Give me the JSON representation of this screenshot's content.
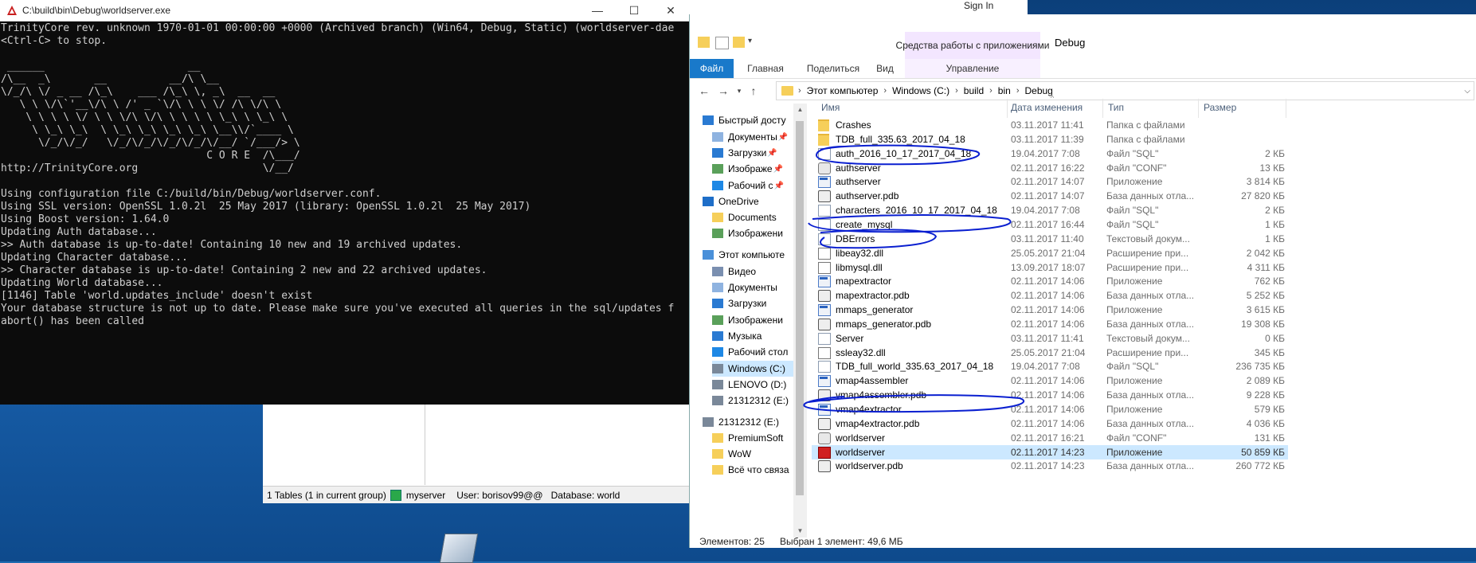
{
  "console": {
    "title": "C:\\build\\bin\\Debug\\worldserver.exe",
    "lines": [
      "TrinityCore rev. unknown 1970-01-01 00:00:00 +0000 (Archived branch) (Win64, Debug, Static) (worldserver-dae",
      "<Ctrl-C> to stop.",
      "",
      " ______                       __",
      "/\\__  _\\       __          __/\\ \\__",
      "\\/_/\\ \\/ _ __ /\\_\\    ___ /\\_\\ \\, _\\  __  __",
      "   \\ \\ \\/\\`'__\\/\\ \\ /' _ `\\/\\ \\ \\ \\/ /\\ \\/\\ \\",
      "    \\ \\ \\ \\ \\/ \\ \\ \\/\\ \\/\\ \\ \\ \\ \\ \\_\\ \\ \\_\\ \\",
      "     \\ \\_\\ \\_\\  \\ \\_\\ \\_\\ \\_\\ \\_\\ \\__\\\\/`____ \\",
      "      \\/_/\\/_/   \\/_/\\/_/\\/_/\\/_/\\/__/ `/___/> \\",
      "                                 C O R E  /\\___/",
      "http://TrinityCore.org                    \\/__/",
      "",
      "Using configuration file C:/build/bin/Debug/worldserver.conf.",
      "Using SSL version: OpenSSL 1.0.2l  25 May 2017 (library: OpenSSL 1.0.2l  25 May 2017)",
      "Using Boost version: 1.64.0",
      "Updating Auth database...",
      ">> Auth database is up-to-date! Containing 10 new and 19 archived updates.",
      "Updating Character database...",
      ">> Character database is up-to-date! Containing 2 new and 22 archived updates.",
      "Updating World database...",
      "[1146] Table 'world.updates_include' doesn't exist",
      "Your database structure is not up to date. Please make sure you've executed all queries in the sql/updates f",
      "abort() has been called"
    ]
  },
  "bgapp": {
    "status_tables": "1 Tables (1 in current group)",
    "server": "myserver",
    "user": "User: borisov99@@",
    "database": "Database: world"
  },
  "signin": "Sign In",
  "explorer": {
    "context_tab": "Средства работы с приложениями",
    "context_sub": "Управление",
    "window_title": "Debug",
    "ribbon_tabs": [
      "Файл",
      "Главная",
      "Поделиться",
      "Вид"
    ],
    "breadcrumb": [
      "Этот компьютер",
      "Windows (C:)",
      "build",
      "bin",
      "Debug"
    ],
    "columns": {
      "name": "Имя",
      "date": "Дата изменения",
      "type": "Тип",
      "size": "Размер"
    },
    "nav": [
      {
        "label": "Быстрый досту",
        "icon": "star-icon",
        "color": "#2a7ad2",
        "indent": 0
      },
      {
        "label": "Документы",
        "icon": "documents-icon",
        "color": "#8fb3e0",
        "indent": 1,
        "pinned": true
      },
      {
        "label": "Загрузки",
        "icon": "download-icon",
        "color": "#2a7ad2",
        "indent": 1,
        "pinned": true
      },
      {
        "label": "Изображе",
        "icon": "pictures-icon",
        "color": "#5aa05a",
        "indent": 1,
        "pinned": true
      },
      {
        "label": "Рабочий с",
        "icon": "desktop-icon",
        "color": "#1e88e5",
        "indent": 1,
        "pinned": true
      },
      {
        "label": "OneDrive",
        "icon": "onedrive-icon",
        "color": "#1e6ec8",
        "indent": 0
      },
      {
        "label": "Documents",
        "icon": "folder-icon",
        "color": "#f6cf5a",
        "indent": 1
      },
      {
        "label": "Изображени",
        "icon": "pictures-icon",
        "color": "#5aa05a",
        "indent": 1
      },
      {
        "label": "Этот компьюте",
        "icon": "computer-icon",
        "color": "#4a90d9",
        "indent": 0
      },
      {
        "label": "Видео",
        "icon": "video-icon",
        "color": "#7a8fb0",
        "indent": 1
      },
      {
        "label": "Документы",
        "icon": "documents-icon",
        "color": "#8fb3e0",
        "indent": 1
      },
      {
        "label": "Загрузки",
        "icon": "download-icon",
        "color": "#2a7ad2",
        "indent": 1
      },
      {
        "label": "Изображени",
        "icon": "pictures-icon",
        "color": "#5aa05a",
        "indent": 1
      },
      {
        "label": "Музыка",
        "icon": "music-icon",
        "color": "#2a7ad2",
        "indent": 1
      },
      {
        "label": "Рабочий стол",
        "icon": "desktop-icon",
        "color": "#1e88e5",
        "indent": 1
      },
      {
        "label": "Windows (C:)",
        "icon": "drive-icon",
        "color": "#7a8899",
        "indent": 1,
        "selected": true
      },
      {
        "label": "LENOVO (D:)",
        "icon": "drive-icon",
        "color": "#7a8899",
        "indent": 1
      },
      {
        "label": "21312312 (E:)",
        "icon": "drive-icon",
        "color": "#7a8899",
        "indent": 1
      },
      {
        "label": "21312312 (E:)",
        "icon": "drive-icon",
        "color": "#7a8899",
        "indent": 0
      },
      {
        "label": "PremiumSoft",
        "icon": "folder-icon",
        "color": "#f6cf5a",
        "indent": 1
      },
      {
        "label": "WoW",
        "icon": "folder-icon",
        "color": "#f6cf5a",
        "indent": 1
      },
      {
        "label": "Всё что связа",
        "icon": "folder-icon",
        "color": "#f6cf5a",
        "indent": 1
      }
    ],
    "files": [
      {
        "name": "Crashes",
        "date": "03.11.2017 11:41",
        "type": "Папка с файлами",
        "size": "",
        "icon": "folder"
      },
      {
        "name": "TDB_full_335.63_2017_04_18",
        "date": "03.11.2017 11:39",
        "type": "Папка с файлами",
        "size": "",
        "icon": "folder"
      },
      {
        "name": "auth_2016_10_17_2017_04_18",
        "date": "19.04.2017 7:08",
        "type": "Файл \"SQL\"",
        "size": "2 КБ",
        "icon": "doc"
      },
      {
        "name": "authserver",
        "date": "02.11.2017 16:22",
        "type": "Файл \"CONF\"",
        "size": "13 КБ",
        "icon": "gear"
      },
      {
        "name": "authserver",
        "date": "02.11.2017 14:07",
        "type": "Приложение",
        "size": "3 814 КБ",
        "icon": "app"
      },
      {
        "name": "authserver.pdb",
        "date": "02.11.2017 14:07",
        "type": "База данных отла...",
        "size": "27 820 КБ",
        "icon": "db"
      },
      {
        "name": "characters_2016_10_17_2017_04_18",
        "date": "19.04.2017 7:08",
        "type": "Файл \"SQL\"",
        "size": "2 КБ",
        "icon": "doc"
      },
      {
        "name": "create_mysql",
        "date": "02.11.2017 16:44",
        "type": "Файл \"SQL\"",
        "size": "1 КБ",
        "icon": "doc"
      },
      {
        "name": "DBErrors",
        "date": "03.11.2017 11:40",
        "type": "Текстовый докум...",
        "size": "1 КБ",
        "icon": "doc"
      },
      {
        "name": "libeay32.dll",
        "date": "25.05.2017 21:04",
        "type": "Расширение при...",
        "size": "2 042 КБ",
        "icon": "dll"
      },
      {
        "name": "libmysql.dll",
        "date": "13.09.2017 18:07",
        "type": "Расширение при...",
        "size": "4 311 КБ",
        "icon": "dll"
      },
      {
        "name": "mapextractor",
        "date": "02.11.2017 14:06",
        "type": "Приложение",
        "size": "762 КБ",
        "icon": "app"
      },
      {
        "name": "mapextractor.pdb",
        "date": "02.11.2017 14:06",
        "type": "База данных отла...",
        "size": "5 252 КБ",
        "icon": "db"
      },
      {
        "name": "mmaps_generator",
        "date": "02.11.2017 14:06",
        "type": "Приложение",
        "size": "3 615 КБ",
        "icon": "app"
      },
      {
        "name": "mmaps_generator.pdb",
        "date": "02.11.2017 14:06",
        "type": "База данных отла...",
        "size": "19 308 КБ",
        "icon": "db"
      },
      {
        "name": "Server",
        "date": "03.11.2017 11:41",
        "type": "Текстовый докум...",
        "size": "0 КБ",
        "icon": "doc"
      },
      {
        "name": "ssleay32.dll",
        "date": "25.05.2017 21:04",
        "type": "Расширение при...",
        "size": "345 КБ",
        "icon": "dll"
      },
      {
        "name": "TDB_full_world_335.63_2017_04_18",
        "date": "19.04.2017 7:08",
        "type": "Файл \"SQL\"",
        "size": "236 735 КБ",
        "icon": "doc"
      },
      {
        "name": "vmap4assembler",
        "date": "02.11.2017 14:06",
        "type": "Приложение",
        "size": "2 089 КБ",
        "icon": "app"
      },
      {
        "name": "vmap4assembler.pdb",
        "date": "02.11.2017 14:06",
        "type": "База данных отла...",
        "size": "9 228 КБ",
        "icon": "db"
      },
      {
        "name": "vmap4extractor",
        "date": "02.11.2017 14:06",
        "type": "Приложение",
        "size": "579 КБ",
        "icon": "app"
      },
      {
        "name": "vmap4extractor.pdb",
        "date": "02.11.2017 14:06",
        "type": "База данных отла...",
        "size": "4 036 КБ",
        "icon": "db"
      },
      {
        "name": "worldserver",
        "date": "02.11.2017 16:21",
        "type": "Файл \"CONF\"",
        "size": "131 КБ",
        "icon": "gear"
      },
      {
        "name": "worldserver",
        "date": "02.11.2017 14:23",
        "type": "Приложение",
        "size": "50 859 КБ",
        "icon": "wsrv",
        "selected": true
      },
      {
        "name": "worldserver.pdb",
        "date": "02.11.2017 14:23",
        "type": "База данных отла...",
        "size": "260 772 КБ",
        "icon": "db"
      }
    ],
    "status_count": "Элементов: 25",
    "status_selected": "Выбран 1 элемент: 49,6 МБ"
  }
}
